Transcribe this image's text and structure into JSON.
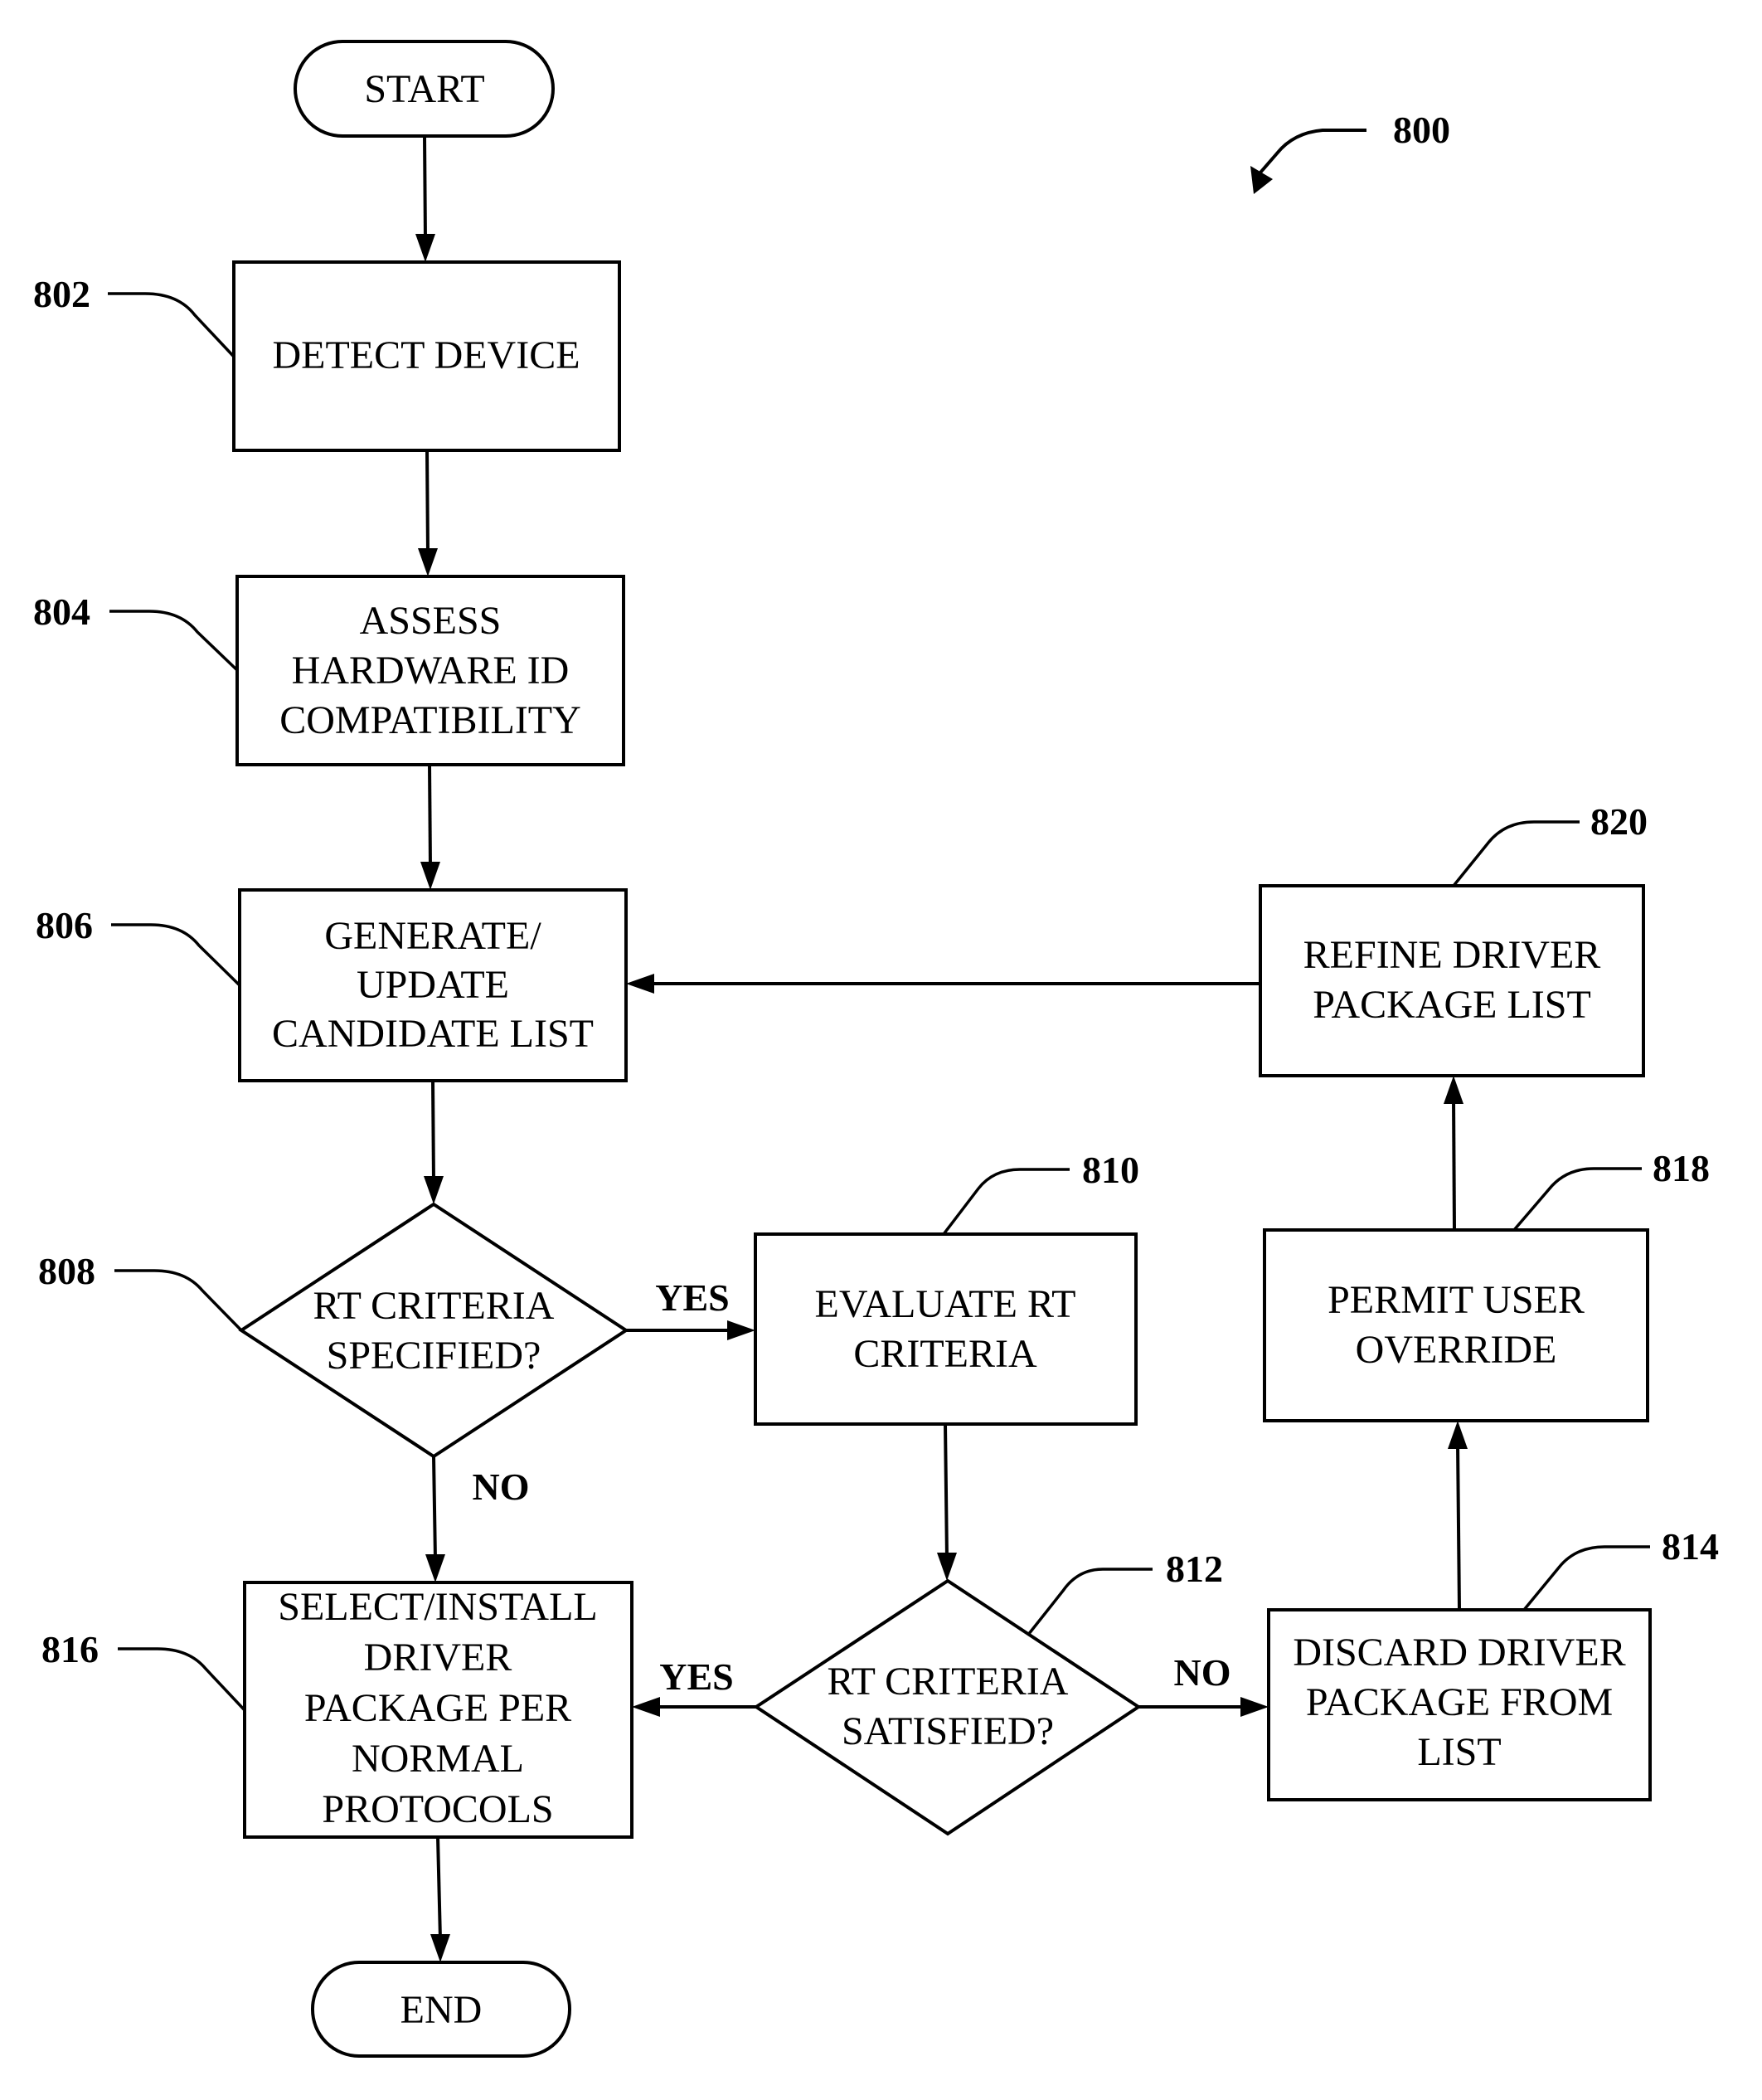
{
  "figure": {
    "ref": "800",
    "start": "START",
    "end": "END"
  },
  "steps": {
    "s802": {
      "ref": "802",
      "lines": [
        "DETECT DEVICE"
      ]
    },
    "s804": {
      "ref": "804",
      "lines": [
        "ASSESS",
        "HARDWARE ID",
        "COMPATIBILITY"
      ]
    },
    "s806": {
      "ref": "806",
      "lines": [
        "GENERATE/",
        "UPDATE",
        "CANDIDATE LIST"
      ]
    },
    "s808": {
      "ref": "808",
      "lines": [
        "RT CRITERIA",
        "SPECIFIED?"
      ]
    },
    "s810": {
      "ref": "810",
      "lines": [
        "EVALUATE RT",
        "CRITERIA"
      ]
    },
    "s812": {
      "ref": "812",
      "lines": [
        "RT CRITERIA",
        "SATISFIED?"
      ]
    },
    "s814": {
      "ref": "814",
      "lines": [
        "DISCARD DRIVER",
        "PACKAGE FROM",
        "LIST"
      ]
    },
    "s816": {
      "ref": "816",
      "lines": [
        "SELECT/INSTALL",
        "DRIVER",
        "PACKAGE PER",
        "NORMAL",
        "PROTOCOLS"
      ]
    },
    "s818": {
      "ref": "818",
      "lines": [
        "PERMIT USER",
        "OVERRIDE"
      ]
    },
    "s820": {
      "ref": "820",
      "lines": [
        "REFINE DRIVER",
        "PACKAGE LIST"
      ]
    }
  },
  "branches": {
    "d808_yes": "YES",
    "d808_no": "NO",
    "d812_yes": "YES",
    "d812_no": "NO"
  }
}
